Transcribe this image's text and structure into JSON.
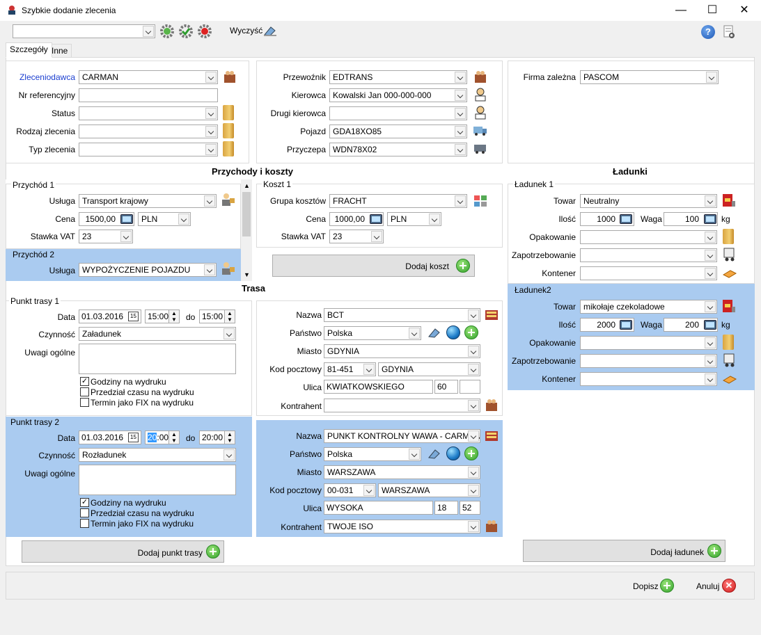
{
  "window": {
    "title": "Szybkie dodanie zlecenia"
  },
  "toolbar": {
    "combo_value": "",
    "clear_label": "Wyczyść"
  },
  "tabs": [
    "Szczegóły",
    "Inne"
  ],
  "order": {
    "client_label": "Zleceniodawca",
    "client": "CARMAN",
    "ref_label": "Nr referencyjny",
    "ref": "",
    "status_label": "Status",
    "status": "",
    "kind_label": "Rodzaj zlecenia",
    "kind": "",
    "type_label": "Typ zlecenia",
    "type": ""
  },
  "carrier": {
    "carrier_label": "Przewoźnik",
    "carrier": "EDTRANS",
    "driver_label": "Kierowca",
    "driver": "Kowalski Jan 000-000-000",
    "driver2_label": "Drugi kierowca",
    "driver2": "",
    "vehicle_label": "Pojazd",
    "vehicle": "GDA18XO85",
    "trailer_label": "Przyczepa",
    "trailer": "WDN78X02"
  },
  "company": {
    "label": "Firma zależna",
    "value": "PASCOM"
  },
  "sections": {
    "revenue": "Przychody i koszty",
    "cargo": "Ładunki",
    "route": "Trasa"
  },
  "revenue1": {
    "title": "Przychód 1",
    "service_label": "Usługa",
    "service": "Transport krajowy",
    "price_label": "Cena",
    "price": "1500,00",
    "currency": "PLN",
    "vat_label": "Stawka VAT",
    "vat": "23"
  },
  "revenue2": {
    "title": "Przychód 2",
    "service_label": "Usługa",
    "service": "WYPOŻYCZENIE POJAZDU"
  },
  "cost1": {
    "title": "Koszt 1",
    "group_label": "Grupa kosztów",
    "group": "FRACHT",
    "price_label": "Cena",
    "price": "1000,00",
    "currency": "PLN",
    "vat_label": "Stawka VAT",
    "vat": "23",
    "add_label": "Dodaj koszt"
  },
  "cargo1": {
    "title": "Ładunek 1",
    "goods_label": "Towar",
    "goods": "Neutralny",
    "qty_label": "Ilość",
    "qty": "1000",
    "weight_label": "Waga",
    "weight": "100",
    "unit": "kg",
    "pack_label": "Opakowanie",
    "pack": "",
    "demand_label": "Zapotrzebowanie",
    "demand": "",
    "container_label": "Kontener",
    "container": ""
  },
  "cargo2": {
    "title": "Ładunek2",
    "goods_label": "Towar",
    "goods": "mikołaje czekoladowe",
    "qty_label": "Ilość",
    "qty": "2000",
    "weight_label": "Waga",
    "weight": "200",
    "unit": "kg",
    "pack_label": "Opakowanie",
    "pack": "",
    "demand_label": "Zapotrzebowanie",
    "demand": "",
    "container_label": "Kontener",
    "container": ""
  },
  "point1": {
    "title": "Punkt trasy 1",
    "date_label": "Data",
    "date": "01.03.2016",
    "time_from": "15:00",
    "to_label": "do",
    "time_to": "15:00",
    "activity_label": "Czynność",
    "activity": "Załadunek",
    "notes_label": "Uwagi ogólne",
    "chk1": "Godziny na wydruku",
    "chk2": "Przedział czasu na wydruku",
    "chk3": "Termin jako FIX na wydruku"
  },
  "addr1": {
    "name_label": "Nazwa",
    "name": "BCT",
    "country_label": "Państwo",
    "country": "Polska",
    "city_label": "Miasto",
    "city": "GDYNIA",
    "zip_label": "Kod pocztowy",
    "zip": "81-451",
    "zip_city": "GDYNIA",
    "street_label": "Ulica",
    "street": "KWIATKOWSKIEGO",
    "no": "60",
    "flat": "",
    "contractor_label": "Kontrahent",
    "contractor": ""
  },
  "point2": {
    "title": "Punkt trasy 2",
    "date_label": "Data",
    "date": "01.03.2016",
    "time_from_sel": "20",
    "time_from_rest": ":00",
    "to_label": "do",
    "time_to": "20:00",
    "activity_label": "Czynność",
    "activity": "Rozładunek",
    "notes_label": "Uwagi ogólne",
    "chk1": "Godziny na wydruku",
    "chk2": "Przedział czasu na wydruku",
    "chk3": "Termin jako FIX na wydruku"
  },
  "addr2": {
    "name_label": "Nazwa",
    "name": "PUNKT KONTROLNY WAWA - CARMAN",
    "country_label": "Państwo",
    "country": "Polska",
    "city_label": "Miasto",
    "city": "WARSZAWA",
    "zip_label": "Kod pocztowy",
    "zip": "00-031",
    "zip_city": "WARSZAWA",
    "street_label": "Ulica",
    "street": "WYSOKA",
    "no": "18",
    "flat": "52",
    "contractor_label": "Kontrahent",
    "contractor": "TWOJE ISO"
  },
  "buttons": {
    "add_point": "Dodaj punkt trasy",
    "add_cargo": "Dodaj ładunek",
    "submit": "Dopisz",
    "cancel": "Anuluj"
  }
}
